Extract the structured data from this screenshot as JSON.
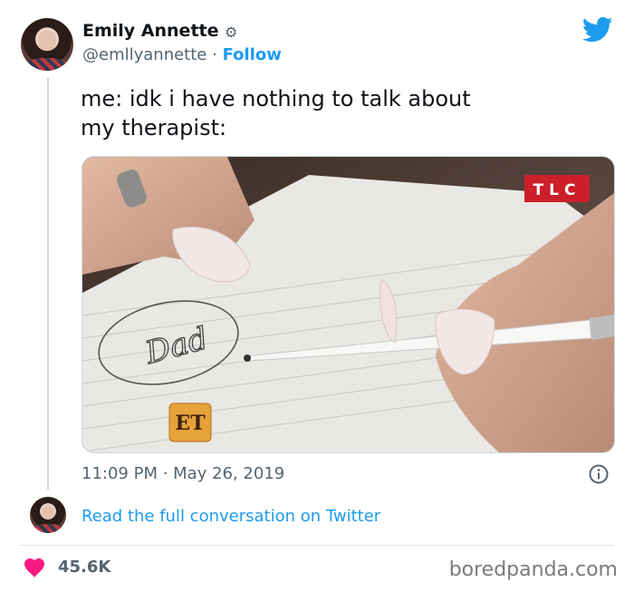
{
  "author": {
    "display_name": "Emily Annette",
    "handle": "@emllyannette",
    "separator": "·",
    "follow_label": "Follow"
  },
  "tweet": {
    "text": "me: idk i have nothing to talk about\nmy therapist:",
    "timestamp": "11:09 PM · May 26, 2019"
  },
  "media": {
    "notebook_word": "Dad",
    "channel_logo": "TLC",
    "corner_logo": "ET"
  },
  "conversation": {
    "read_link": "Read the full conversation on Twitter"
  },
  "stats": {
    "likes": "45.6K"
  },
  "watermark": "boredpanda.com",
  "icons": {
    "platform": "twitter-bird-icon",
    "verified": "verified-badge-icon",
    "info": "info-icon",
    "like": "heart-icon"
  },
  "colors": {
    "link": "#1d9bf0",
    "heart": "#f91880",
    "secondary_text": "#536471"
  }
}
